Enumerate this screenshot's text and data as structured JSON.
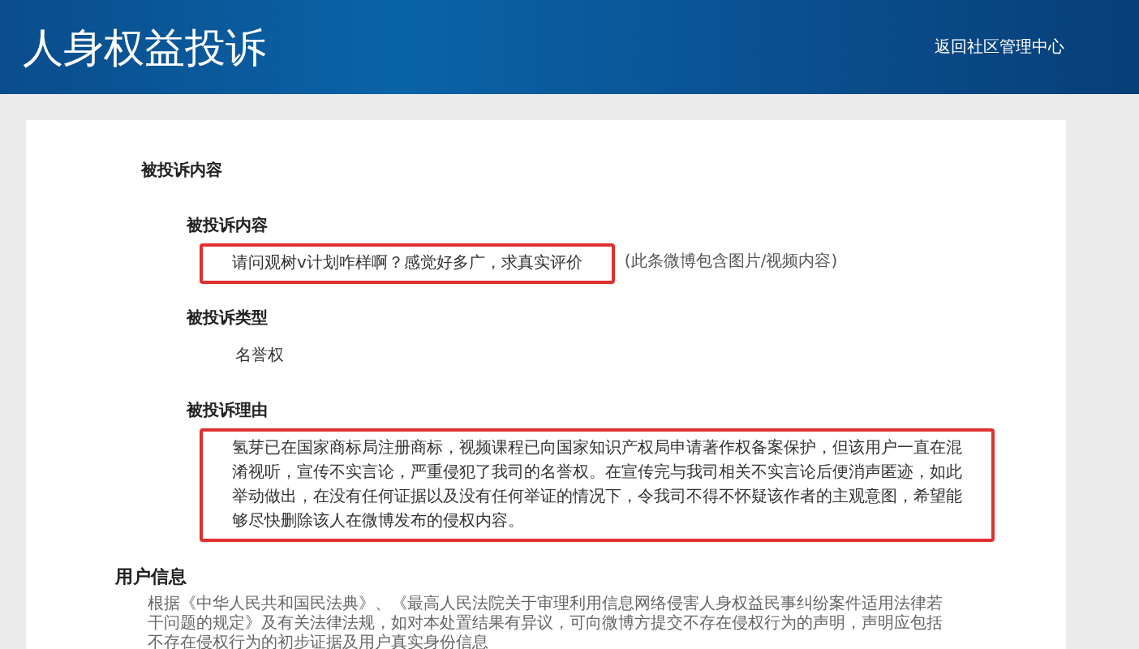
{
  "header": {
    "title": "人身权益投诉",
    "back_link": "返回社区管理中心"
  },
  "section": {
    "title": "被投诉内容",
    "fields": [
      {
        "label": "被投诉内容",
        "value": "请问观树v计划咋样啊？感觉好多广，求真实评价",
        "note": "(此条微博包含图片/视频内容)",
        "highlighted": true
      },
      {
        "label": "被投诉类型",
        "value": "名誉权",
        "highlighted": false
      },
      {
        "label": "被投诉理由",
        "value": "氢芽已在国家商标局注册商标，视频课程已向国家知识产权局申请著作权备案保护，但该用户一直在混淆视听，宣传不实言论，严重侵犯了我司的名誉权。在宣传完与我司相关不实言论后便消声匿迹，如此举动做出，在没有任何证据以及没有任何举证的情况下，令我司不得不怀疑该作者的主观意图，希望能够尽快删除该人在微博发布的侵权内容。",
        "highlighted": true
      }
    ]
  },
  "user_info": {
    "title": "用户信息",
    "notice": "根据《中华人民共和国民法典》、《最高人民法院关于审理利用信息网络侵害人身权益民事纠纷案件适用法律若干问题的规定》及有关法律法规，如对本处置结果有异议，可向微博方提交不存在侵权行为的声明，声明应包括不存在侵权行为的初步证据及用户真实身份信息"
  }
}
